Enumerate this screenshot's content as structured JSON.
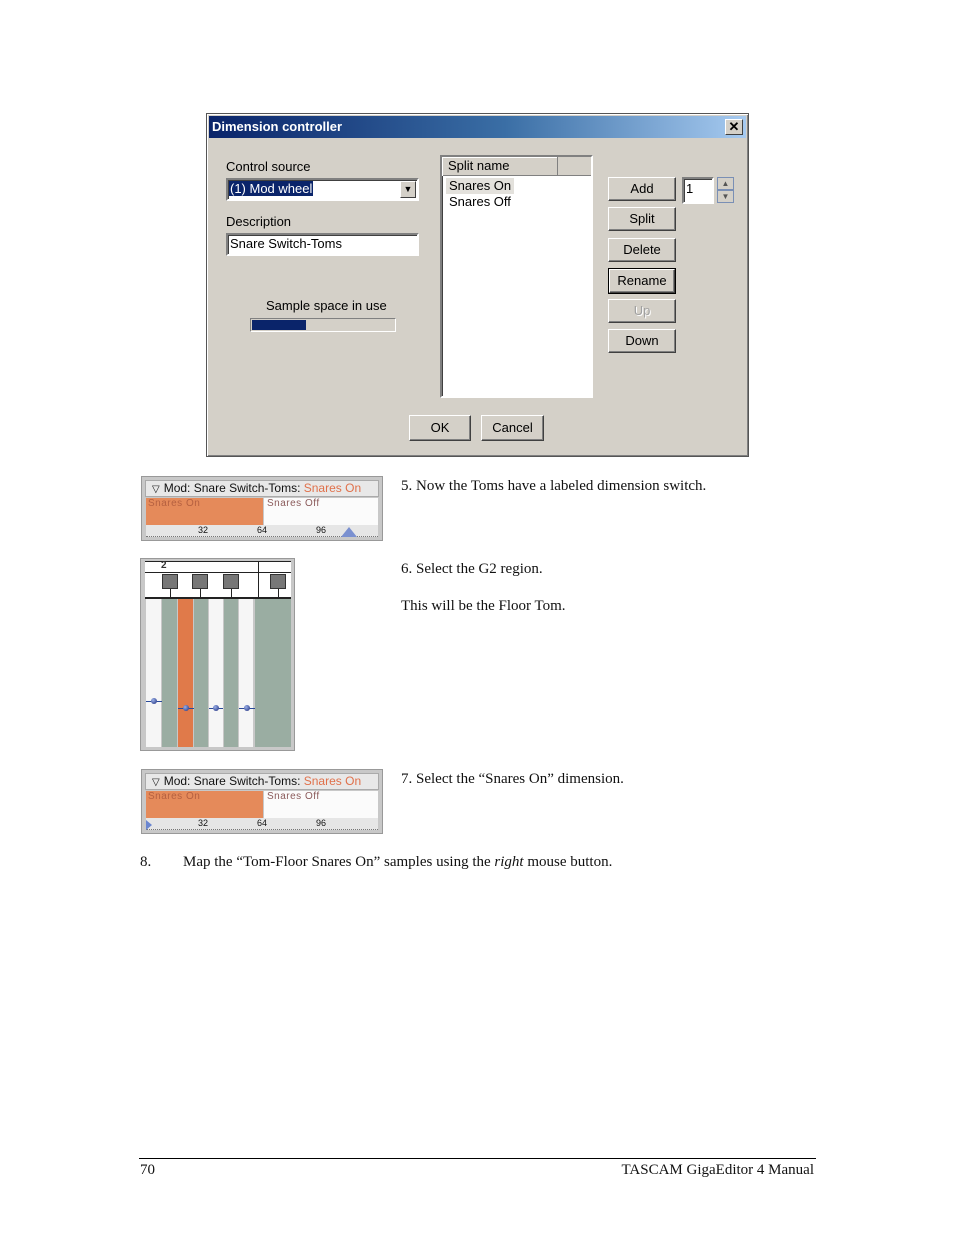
{
  "dialog": {
    "title": "Dimension controller",
    "close_label": "✕",
    "control_source": {
      "label": "Control source",
      "value": "(1) Mod wheel"
    },
    "description": {
      "label": "Description",
      "value": "Snare Switch-Toms"
    },
    "sample_space": {
      "label": "Sample space in use",
      "fraction": 0.38
    },
    "split_list": {
      "header": "Split name",
      "items": [
        "Snares On",
        "Snares Off"
      ],
      "selected": 0
    },
    "buttons": {
      "add": "Add",
      "split": "Split",
      "delete": "Delete",
      "rename": "Rename",
      "up": "Up",
      "down": "Down",
      "ok": "OK",
      "cancel": "Cancel"
    },
    "count_value": "1",
    "spin_up": "▲",
    "spin_down": "▼",
    "dropdown_icon": "▼"
  },
  "mod_strip_1": {
    "prefix": "Mod: Snare Switch-Toms: ",
    "current": "Snares On",
    "toggle_icon": "▽",
    "zones": [
      "Snares On",
      "Snares Off"
    ],
    "ticks": [
      "32",
      "64",
      "96"
    ],
    "marker_value": 110
  },
  "keyboard": {
    "octave_label": "2",
    "colors": {
      "selected": "#e07a4a",
      "region": "#9aada2",
      "white": "#f6f6f6"
    }
  },
  "mod_strip_2": {
    "prefix": "Mod: Snare Switch-Toms: ",
    "current": "Snares On",
    "toggle_icon": "▽",
    "zones": [
      "Snares On",
      "Snares Off"
    ],
    "ticks": [
      "32",
      "64",
      "96"
    ],
    "marker_value": 0
  },
  "steps": {
    "s5": "5. Now the Toms have a labeled dimension switch.",
    "s6": "6. Select the G2 region.",
    "s6_note": "This will be the Floor Tom.",
    "s7": "7. Select the “Snares On” dimension.",
    "s8_num": "8.",
    "s8_pre": "Map the “Tom-Floor Snares On” samples using the ",
    "s8_em": "right",
    "s8_post": " mouse button."
  },
  "footer": {
    "page_number": "70",
    "title": "TASCAM GigaEditor 4 Manual"
  }
}
